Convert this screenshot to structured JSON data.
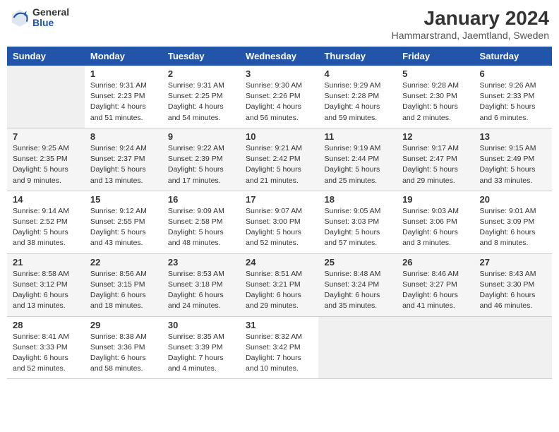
{
  "header": {
    "logo_general": "General",
    "logo_blue": "Blue",
    "title": "January 2024",
    "subtitle": "Hammarstrand, Jaemtland, Sweden"
  },
  "weekdays": [
    "Sunday",
    "Monday",
    "Tuesday",
    "Wednesday",
    "Thursday",
    "Friday",
    "Saturday"
  ],
  "weeks": [
    [
      {
        "day": "",
        "info": ""
      },
      {
        "day": "1",
        "info": "Sunrise: 9:31 AM\nSunset: 2:23 PM\nDaylight: 4 hours\nand 51 minutes."
      },
      {
        "day": "2",
        "info": "Sunrise: 9:31 AM\nSunset: 2:25 PM\nDaylight: 4 hours\nand 54 minutes."
      },
      {
        "day": "3",
        "info": "Sunrise: 9:30 AM\nSunset: 2:26 PM\nDaylight: 4 hours\nand 56 minutes."
      },
      {
        "day": "4",
        "info": "Sunrise: 9:29 AM\nSunset: 2:28 PM\nDaylight: 4 hours\nand 59 minutes."
      },
      {
        "day": "5",
        "info": "Sunrise: 9:28 AM\nSunset: 2:30 PM\nDaylight: 5 hours\nand 2 minutes."
      },
      {
        "day": "6",
        "info": "Sunrise: 9:26 AM\nSunset: 2:33 PM\nDaylight: 5 hours\nand 6 minutes."
      }
    ],
    [
      {
        "day": "7",
        "info": "Sunrise: 9:25 AM\nSunset: 2:35 PM\nDaylight: 5 hours\nand 9 minutes."
      },
      {
        "day": "8",
        "info": "Sunrise: 9:24 AM\nSunset: 2:37 PM\nDaylight: 5 hours\nand 13 minutes."
      },
      {
        "day": "9",
        "info": "Sunrise: 9:22 AM\nSunset: 2:39 PM\nDaylight: 5 hours\nand 17 minutes."
      },
      {
        "day": "10",
        "info": "Sunrise: 9:21 AM\nSunset: 2:42 PM\nDaylight: 5 hours\nand 21 minutes."
      },
      {
        "day": "11",
        "info": "Sunrise: 9:19 AM\nSunset: 2:44 PM\nDaylight: 5 hours\nand 25 minutes."
      },
      {
        "day": "12",
        "info": "Sunrise: 9:17 AM\nSunset: 2:47 PM\nDaylight: 5 hours\nand 29 minutes."
      },
      {
        "day": "13",
        "info": "Sunrise: 9:15 AM\nSunset: 2:49 PM\nDaylight: 5 hours\nand 33 minutes."
      }
    ],
    [
      {
        "day": "14",
        "info": "Sunrise: 9:14 AM\nSunset: 2:52 PM\nDaylight: 5 hours\nand 38 minutes."
      },
      {
        "day": "15",
        "info": "Sunrise: 9:12 AM\nSunset: 2:55 PM\nDaylight: 5 hours\nand 43 minutes."
      },
      {
        "day": "16",
        "info": "Sunrise: 9:09 AM\nSunset: 2:58 PM\nDaylight: 5 hours\nand 48 minutes."
      },
      {
        "day": "17",
        "info": "Sunrise: 9:07 AM\nSunset: 3:00 PM\nDaylight: 5 hours\nand 52 minutes."
      },
      {
        "day": "18",
        "info": "Sunrise: 9:05 AM\nSunset: 3:03 PM\nDaylight: 5 hours\nand 57 minutes."
      },
      {
        "day": "19",
        "info": "Sunrise: 9:03 AM\nSunset: 3:06 PM\nDaylight: 6 hours\nand 3 minutes."
      },
      {
        "day": "20",
        "info": "Sunrise: 9:01 AM\nSunset: 3:09 PM\nDaylight: 6 hours\nand 8 minutes."
      }
    ],
    [
      {
        "day": "21",
        "info": "Sunrise: 8:58 AM\nSunset: 3:12 PM\nDaylight: 6 hours\nand 13 minutes."
      },
      {
        "day": "22",
        "info": "Sunrise: 8:56 AM\nSunset: 3:15 PM\nDaylight: 6 hours\nand 18 minutes."
      },
      {
        "day": "23",
        "info": "Sunrise: 8:53 AM\nSunset: 3:18 PM\nDaylight: 6 hours\nand 24 minutes."
      },
      {
        "day": "24",
        "info": "Sunrise: 8:51 AM\nSunset: 3:21 PM\nDaylight: 6 hours\nand 29 minutes."
      },
      {
        "day": "25",
        "info": "Sunrise: 8:48 AM\nSunset: 3:24 PM\nDaylight: 6 hours\nand 35 minutes."
      },
      {
        "day": "26",
        "info": "Sunrise: 8:46 AM\nSunset: 3:27 PM\nDaylight: 6 hours\nand 41 minutes."
      },
      {
        "day": "27",
        "info": "Sunrise: 8:43 AM\nSunset: 3:30 PM\nDaylight: 6 hours\nand 46 minutes."
      }
    ],
    [
      {
        "day": "28",
        "info": "Sunrise: 8:41 AM\nSunset: 3:33 PM\nDaylight: 6 hours\nand 52 minutes."
      },
      {
        "day": "29",
        "info": "Sunrise: 8:38 AM\nSunset: 3:36 PM\nDaylight: 6 hours\nand 58 minutes."
      },
      {
        "day": "30",
        "info": "Sunrise: 8:35 AM\nSunset: 3:39 PM\nDaylight: 7 hours\nand 4 minutes."
      },
      {
        "day": "31",
        "info": "Sunrise: 8:32 AM\nSunset: 3:42 PM\nDaylight: 7 hours\nand 10 minutes."
      },
      {
        "day": "",
        "info": ""
      },
      {
        "day": "",
        "info": ""
      },
      {
        "day": "",
        "info": ""
      }
    ]
  ]
}
